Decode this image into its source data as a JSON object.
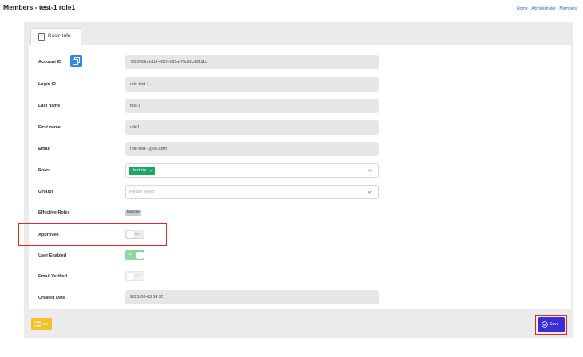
{
  "header": {
    "title": "Members - test-1 role1",
    "breadcrumb": "Home · Administrator · Members"
  },
  "tabs": [
    {
      "label": "Basic Info",
      "icon": "info-icon",
      "active": true
    }
  ],
  "form": {
    "account_id": {
      "label": "Account ID",
      "value": "7929f65b-b1bf-4029-b92a-76c92c42111a"
    },
    "login_id": {
      "label": "Login ID",
      "value": "role-test-1"
    },
    "last_name": {
      "label": "Last name",
      "value": "test-1"
    },
    "first_name": {
      "label": "First name",
      "value": "role1"
    },
    "email": {
      "label": "Email",
      "value": "role-test-1@sk.com"
    },
    "roles": {
      "label": "Roles",
      "tags": [
        "testrole"
      ]
    },
    "groups": {
      "label": "Groups",
      "placeholder": "Please select"
    },
    "effective_roles": {
      "label": "Effective Roles",
      "tags": [
        "testrole"
      ]
    },
    "approved": {
      "label": "Approved",
      "state": "OFF"
    },
    "user_enabled": {
      "label": "User Enabled",
      "state": "ON"
    },
    "email_verified": {
      "label": "Email Verified",
      "state": "OFF"
    },
    "created_date": {
      "label": "Created Date",
      "value": "2021-06-03 14:35"
    }
  },
  "footer": {
    "list_label": "List",
    "save_label": "Save"
  },
  "colors": {
    "primary": "#3b2ed6",
    "tag_green": "#1fa565",
    "list_yellow": "#f4c02a",
    "highlight_red": "#e0252c",
    "copy_blue": "#2f86e8"
  }
}
